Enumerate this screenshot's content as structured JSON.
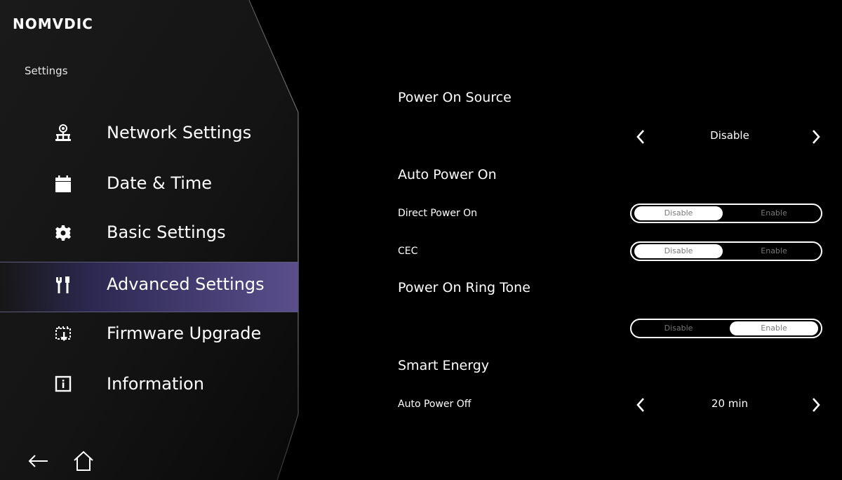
{
  "brand": {
    "logo_text": "NOMVDIC"
  },
  "sidebar": {
    "header": "Settings",
    "items": [
      {
        "label": "Network Settings",
        "icon": "network-icon",
        "active": false
      },
      {
        "label": "Date & Time",
        "icon": "calendar-icon",
        "active": false
      },
      {
        "label": "Basic Settings",
        "icon": "gear-icon",
        "active": false
      },
      {
        "label": "Advanced Settings",
        "icon": "tools-icon",
        "active": true
      },
      {
        "label": "Firmware Upgrade",
        "icon": "firmware-icon",
        "active": false
      },
      {
        "label": "Information",
        "icon": "info-icon",
        "active": false
      }
    ],
    "footer_icons": [
      "back-arrow-icon",
      "home-icon"
    ]
  },
  "main": {
    "power_on_source": {
      "title": "Power On Source",
      "value": "Disable"
    },
    "auto_power_on": {
      "title": "Auto Power On",
      "direct_power_on": {
        "label": "Direct Power On",
        "options": [
          "Disable",
          "Enable"
        ],
        "selected": "Disable"
      },
      "cec": {
        "label": "CEC",
        "options": [
          "Disable",
          "Enable"
        ],
        "selected": "Disable"
      }
    },
    "power_on_ring_tone": {
      "title": "Power On Ring Tone",
      "options": [
        "Disable",
        "Enable"
      ],
      "selected": "Enable"
    },
    "smart_energy": {
      "title": "Smart Energy",
      "auto_power_off": {
        "label": "Auto Power Off",
        "value": "20 min"
      }
    }
  },
  "colors": {
    "background": "#000000",
    "active_highlight": "#4a4178",
    "text": "#ffffff"
  }
}
